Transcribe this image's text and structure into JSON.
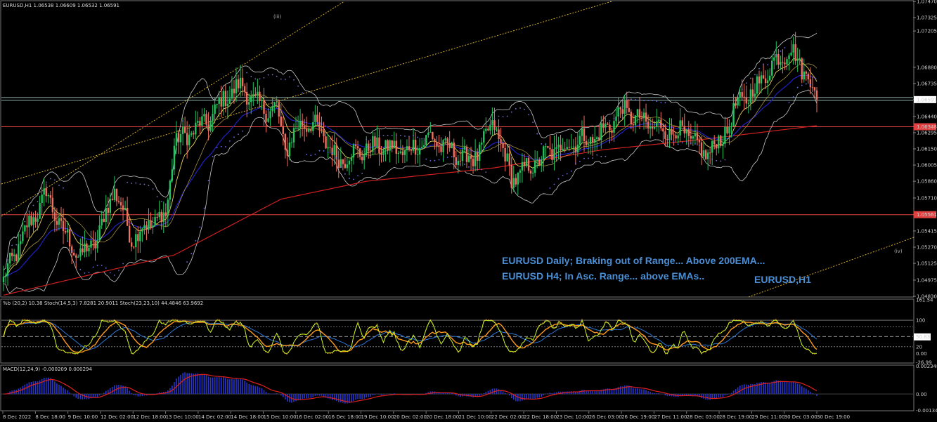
{
  "colors": {
    "background": "#000000",
    "bull": "#22c55e",
    "bear": "#f07060",
    "ema200": "#d02020",
    "ema50": "#2020c8",
    "ema20": "#e6d25a",
    "bollinger": "#c8c8c8",
    "channel": "#d8b02a",
    "level_line": "#e04040",
    "current_line": "#8fb0a8",
    "stoch_fast": "#c8f020",
    "stoch_slow": "#ff9a1a",
    "stoch_dotted": "#d08030",
    "pct_b": "#2a78d8",
    "macd_hist": "#2a36c8",
    "macd_signal": "#e02020",
    "annotation": "#4a8fd6"
  },
  "main": {
    "header": "EURUSD,H1  1.06538 1.06609 1.06532 1.06591",
    "price_ticks": [
      "1.07470",
      "1.07325",
      "1.07205",
      "1.06880",
      "1.06735",
      "1.06591",
      "1.06440",
      "1.06348",
      "1.06295",
      "1.06150",
      "1.06005",
      "1.05860",
      "1.05710",
      "1.05561",
      "1.05415",
      "1.05270",
      "1.05125",
      "1.04975",
      "1.04830"
    ],
    "current_price": "1.06591",
    "level_upper": "1.06348",
    "level_lower": "1.05561",
    "wave_labels": [
      "(iii)",
      "(iv)"
    ],
    "annotation_1": "EURUSD Daily; Braking out of Range... Above 200EMA...",
    "annotation_2": "EURUSD H4; In Asc. Range... above EMAs..",
    "symbol_label": "EURUSD,H1"
  },
  "stoch": {
    "header": "%b (20,2) 10.38  Stoch(14,5,3) 7.8281 20.9011  Stoch(23,23,10) 44.4846 63.9692",
    "ticks": [
      "161.54",
      "100",
      "50.83",
      "20",
      "0.00",
      "-26.99"
    ]
  },
  "macd": {
    "header": "MACD(12,24,9) -0.000209 0.000294",
    "ticks": [
      "0.002348",
      "0.00",
      "-0.001344"
    ]
  },
  "time_axis": [
    "8 Dec 2022",
    "8 Dec 18:00",
    "9 Dec 10:00",
    "12 Dec 02:00",
    "12 Dec 18:00",
    "13 Dec 10:00",
    "14 Dec 02:00",
    "14 Dec 18:00",
    "15 Dec 10:00",
    "16 Dec 02:00",
    "16 Dec 18:00",
    "19 Dec 10:00",
    "20 Dec 02:00",
    "20 Dec 18:00",
    "21 Dec 10:00",
    "22 Dec 02:00",
    "22 Dec 18:00",
    "23 Dec 10:00",
    "26 Dec 03:00",
    "26 Dec 19:00",
    "27 Dec 11:00",
    "28 Dec 03:00",
    "28 Dec 19:00",
    "29 Dec 11:00",
    "30 Dec 03:00",
    "30 Dec 19:00"
  ],
  "chart_data": {
    "type": "candlestick",
    "symbol": "EURUSD",
    "timeframe": "H1",
    "ohlc_last": {
      "open": 1.06538,
      "high": 1.06609,
      "low": 1.06532,
      "close": 1.06591
    },
    "ylim": [
      1.0483,
      1.0747
    ],
    "waypoints": [
      [
        0,
        1.0498
      ],
      [
        10,
        1.054
      ],
      [
        20,
        1.0575
      ],
      [
        28,
        1.054
      ],
      [
        36,
        1.0518
      ],
      [
        44,
        1.0535
      ],
      [
        52,
        1.058
      ],
      [
        60,
        1.0535
      ],
      [
        68,
        1.0548
      ],
      [
        76,
        1.0555
      ],
      [
        80,
        1.062
      ],
      [
        86,
        1.0628
      ],
      [
        96,
        1.064
      ],
      [
        104,
        1.0662
      ],
      [
        112,
        1.0672
      ],
      [
        118,
        1.0655
      ],
      [
        124,
        1.065
      ],
      [
        128,
        1.065
      ],
      [
        132,
        1.0615
      ],
      [
        140,
        1.064
      ],
      [
        148,
        1.0632
      ],
      [
        156,
        1.0605
      ],
      [
        166,
        1.0612
      ],
      [
        176,
        1.0618
      ],
      [
        188,
        1.0612
      ],
      [
        200,
        1.0625
      ],
      [
        210,
        1.0612
      ],
      [
        220,
        1.0605
      ],
      [
        230,
        1.0638
      ],
      [
        238,
        1.0588
      ],
      [
        246,
        1.0598
      ],
      [
        256,
        1.0612
      ],
      [
        268,
        1.0622
      ],
      [
        278,
        1.0625
      ],
      [
        290,
        1.065
      ],
      [
        300,
        1.0638
      ],
      [
        310,
        1.0632
      ],
      [
        320,
        1.0628
      ],
      [
        328,
        1.061
      ],
      [
        336,
        1.0622
      ],
      [
        344,
        1.0655
      ],
      [
        352,
        1.0668
      ],
      [
        360,
        1.069
      ],
      [
        368,
        1.0705
      ],
      [
        376,
        1.0682
      ],
      [
        382,
        1.0662
      ]
    ],
    "ema200": [
      [
        0,
        1.0484
      ],
      [
        80,
        1.052
      ],
      [
        130,
        1.057
      ],
      [
        170,
        1.0586
      ],
      [
        230,
        1.0598
      ],
      [
        280,
        1.0614
      ],
      [
        330,
        1.0624
      ],
      [
        382,
        1.0636
      ]
    ],
    "levels": [
      1.06348,
      1.05561
    ],
    "current": 1.06591
  }
}
